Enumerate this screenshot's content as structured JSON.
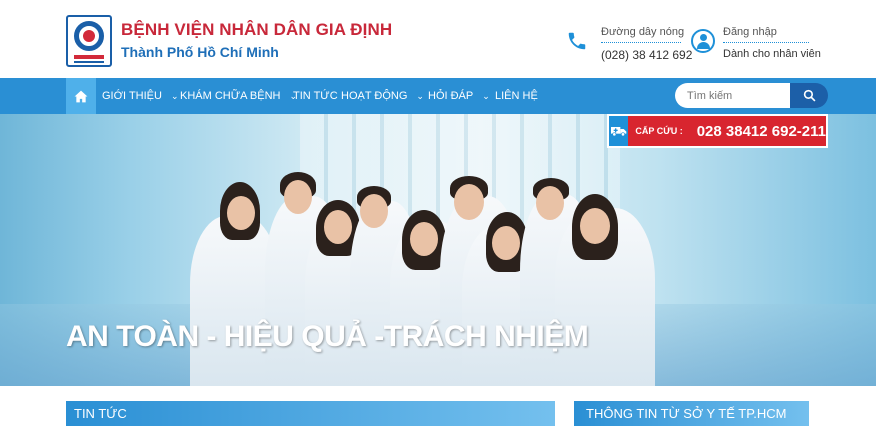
{
  "header": {
    "hospital_name": "BỆNH VIỆN NHÂN DÂN GIA ĐỊNH",
    "city": "Thành Phố Hồ Chí Minh",
    "hotline_label": "Đường dây nóng",
    "hotline_number": "(028) 38 412 692",
    "login_label": "Đăng nhập",
    "login_sub": "Dành cho nhân viên"
  },
  "nav": {
    "items": [
      {
        "label": "GIỚI THIỆU",
        "dropdown": true
      },
      {
        "label": "KHÁM CHỮA BỆNH",
        "dropdown": true
      },
      {
        "label": "TIN TỨC",
        "dropdown": false
      },
      {
        "label": "HOẠT ĐỘNG",
        "dropdown": true
      },
      {
        "label": "HỎI ĐÁP",
        "dropdown": true
      },
      {
        "label": "LIÊN HỆ",
        "dropdown": false
      }
    ],
    "search_placeholder": "Tìm kiếm"
  },
  "emergency": {
    "label": "CẤP CỨU :",
    "number": "028 38412 692-211"
  },
  "hero": {
    "slogan": "AN TOÀN - HIỆU QUẢ -TRÁCH NHIỆM"
  },
  "sections": {
    "news_title": "TIN TỨC",
    "health_dept_title": "THÔNG TIN TỪ SỞ Y TẾ TP.HCM"
  },
  "colors": {
    "brand_blue": "#2a8fd4",
    "brand_red": "#c8283a",
    "emergency_red": "#d8252f"
  }
}
